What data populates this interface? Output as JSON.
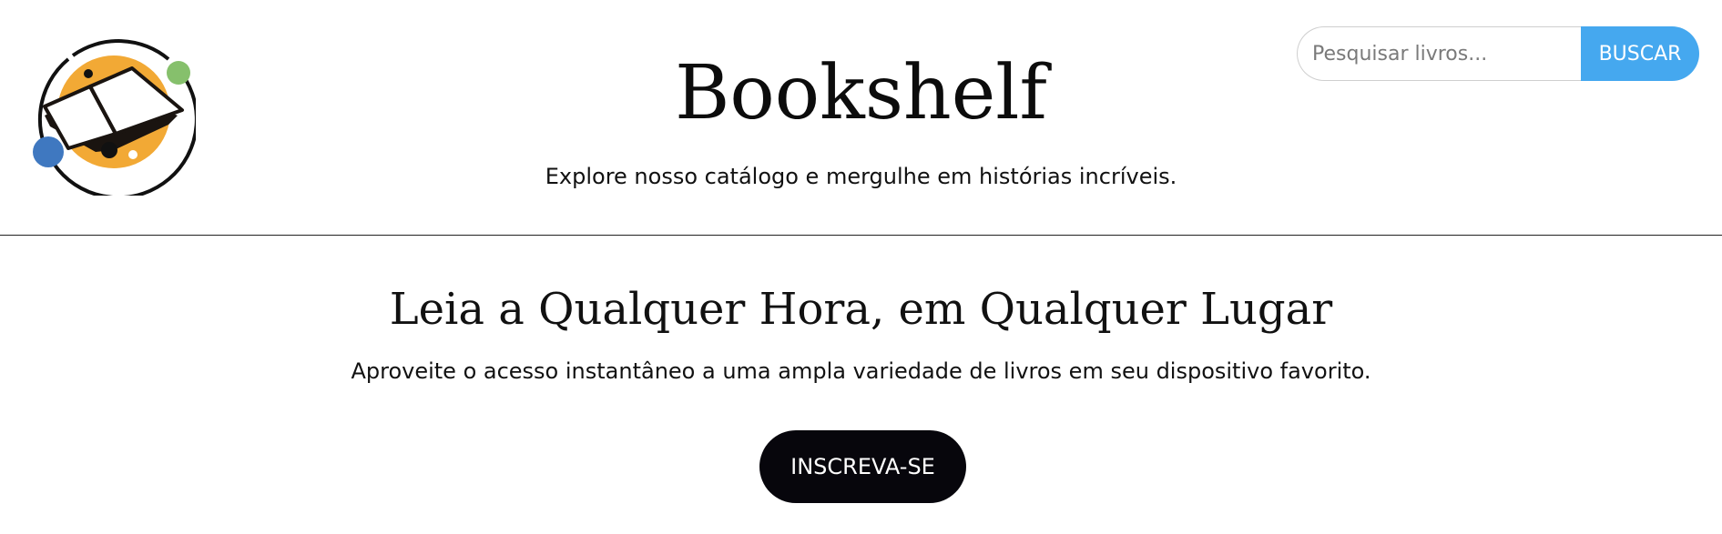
{
  "header": {
    "title": "Bookshelf",
    "tagline": "Explore nosso catálogo e mergulhe em histórias incríveis."
  },
  "search": {
    "placeholder": "Pesquisar livros...",
    "button_label": "BUSCAR"
  },
  "hero": {
    "title": "Leia a Qualquer Hora, em Qualquer Lugar",
    "subtitle": "Aproveite o acesso instantâneo a uma ampla variedade de livros em seu dispositivo favorito.",
    "cta_label": "INSCREVA-SE"
  },
  "logo": {
    "icon": "open-book-icon",
    "colors": {
      "ring": "#111111",
      "accent_orange": "#f2a935",
      "accent_blue": "#3f78c0",
      "accent_green": "#86c06c"
    }
  },
  "colors": {
    "search_button": "#45a8ef",
    "cta_background": "#07060c",
    "divider": "#222222"
  }
}
